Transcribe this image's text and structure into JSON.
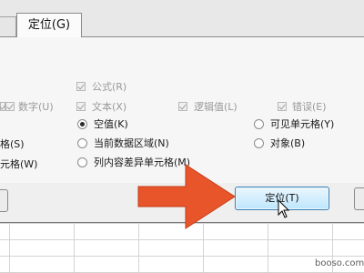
{
  "tabs": {
    "active_label": "定位(G)"
  },
  "formula_group": {
    "items": [
      {
        "label": "公式(R)",
        "checked": true,
        "enabled": false
      },
      {
        "label": "数字(U)",
        "checked": true,
        "enabled": false
      },
      {
        "label": "文本(X)",
        "checked": true,
        "enabled": false
      },
      {
        "label": "逻辑值(L)",
        "checked": true,
        "enabled": false
      },
      {
        "label": "错误(E)",
        "checked": true,
        "enabled": false
      }
    ]
  },
  "radio_options": {
    "left_partial": [
      "格(S)",
      "元格(W)"
    ],
    "middle": [
      {
        "label": "空值(K)",
        "selected": true
      },
      {
        "label": "当前数据区域(N)",
        "selected": false
      },
      {
        "label": "列内容差异单元格(M)",
        "selected": false
      }
    ],
    "right": [
      {
        "label": "可见单元格(Y)",
        "selected": false
      },
      {
        "label": "对象(B)",
        "selected": false
      }
    ]
  },
  "buttons": {
    "locate_label": "定位(T)"
  },
  "icons": {
    "arrow": "orange-arrow-icon",
    "cursor": "mouse-pointer-icon"
  },
  "colors": {
    "arrow": "#e8552a",
    "button_border": "#3c7fb1",
    "button_fill": "#bee6fd"
  },
  "watermark": {
    "text": "booso.com"
  }
}
